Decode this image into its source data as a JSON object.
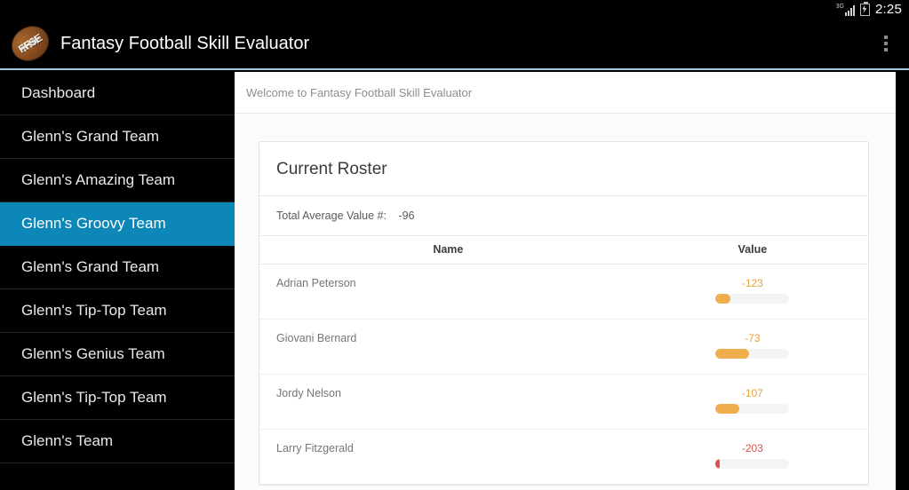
{
  "statusbar": {
    "network_label": "3G",
    "time": "2:25",
    "signal_icon": "signal-bars-icon",
    "battery_icon": "battery-charging-icon"
  },
  "actionbar": {
    "title": "Fantasy Football Skill Evaluator",
    "logo_text": "FFSE",
    "logo_icon": "football-logo-icon",
    "overflow_icon": "overflow-menu-icon",
    "accent_color": "#9ecbe2"
  },
  "sidebar": {
    "selected_index": 3,
    "highlight_color": "#0c87b8",
    "items": [
      {
        "label": "Dashboard"
      },
      {
        "label": "Glenn's Grand Team"
      },
      {
        "label": "Glenn's Amazing Team"
      },
      {
        "label": "Glenn's Groovy Team"
      },
      {
        "label": "Glenn's Grand Team"
      },
      {
        "label": "Glenn's Tip-Top Team"
      },
      {
        "label": "Glenn's Genius Team"
      },
      {
        "label": "Glenn's Tip-Top Team"
      },
      {
        "label": "Glenn's Team"
      }
    ]
  },
  "content": {
    "welcome_text": "Welcome to Fantasy Football Skill Evaluator",
    "card": {
      "title": "Current Roster",
      "total_label": "Total Average Value #:",
      "total_value": "-96",
      "columns": {
        "name": "Name",
        "value": "Value"
      },
      "rows": [
        {
          "name": "Adrian Peterson",
          "value": "-123",
          "percent": 20,
          "state": "warn"
        },
        {
          "name": "Giovani Bernard",
          "value": "-73",
          "percent": 45,
          "state": "warn"
        },
        {
          "name": "Jordy Nelson",
          "value": "-107",
          "percent": 32,
          "state": "warn"
        },
        {
          "name": "Larry Fitzgerald",
          "value": "-203",
          "percent": 6,
          "state": "danger"
        }
      ],
      "warn_color": "#f0ad4e",
      "danger_color": "#d9534f"
    }
  }
}
